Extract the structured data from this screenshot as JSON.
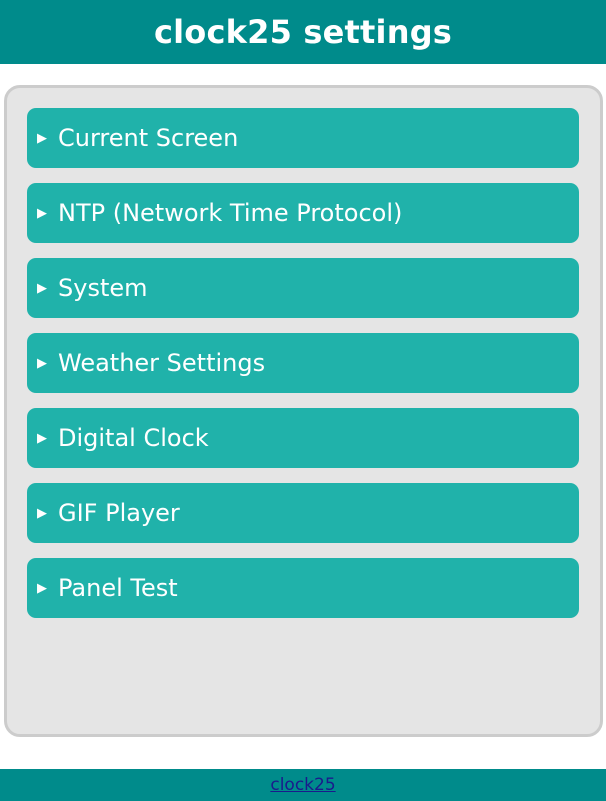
{
  "header": {
    "title": "clock25 settings"
  },
  "sections": [
    {
      "label": "Current Screen",
      "expanded": false
    },
    {
      "label": "NTP (Network Time Protocol)",
      "expanded": false
    },
    {
      "label": "System",
      "expanded": false
    },
    {
      "label": "Weather Settings",
      "expanded": false
    },
    {
      "label": "Digital Clock",
      "expanded": false
    },
    {
      "label": "GIF Player",
      "expanded": false
    },
    {
      "label": "Panel Test",
      "expanded": false
    }
  ],
  "footer": {
    "link_text": "clock25"
  },
  "icons": {
    "collapsed": "triangle-right-icon"
  },
  "colors": {
    "header_bg": "#008b8b",
    "section_bg": "#20b2aa",
    "panel_bg": "#e5e5e5",
    "panel_border": "#cccccc",
    "footer_bg": "#008b8b"
  }
}
